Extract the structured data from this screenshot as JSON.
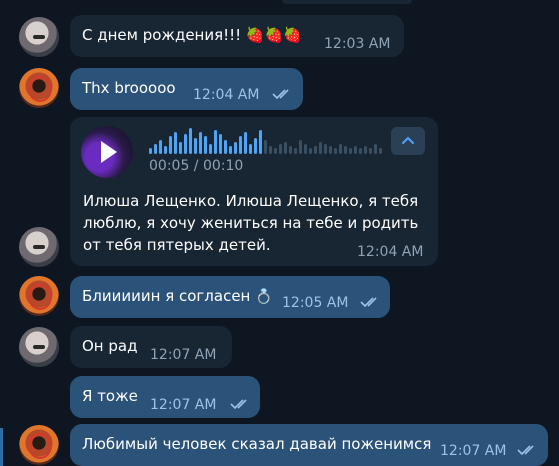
{
  "messages": [
    {
      "from": "friend",
      "text": "С днем рождения!!! 🍓🍓🍓",
      "time": "12:03 AM"
    },
    {
      "from": "me",
      "text": "Thx brooooo",
      "time": "12:04 AM",
      "read": true
    },
    {
      "from": "friend",
      "type": "voice",
      "duration": "00:05 / 00:10",
      "transcript": "Илюша Лещенко. Илюша Лещенко, я тебя люблю, я хочу жениться на тебе и родить от тебя пятерых детей.",
      "time": "12:04 AM"
    },
    {
      "from": "me",
      "text": "Блииииин я согласен",
      "emoji": "💍",
      "time": "12:05 AM",
      "read": true
    },
    {
      "from": "friend",
      "text": "Он рад",
      "time": "12:07 AM"
    },
    {
      "from": "me",
      "text": "Я тоже",
      "time": "12:07 AM",
      "read": true
    },
    {
      "from": "me",
      "text": "Любимый человек сказал давай поженимся",
      "time": "12:07 AM",
      "read": true
    }
  ],
  "colors": {
    "background": "#0e1621",
    "incoming_bubble": "#182533",
    "outgoing_bubble": "#2b5278",
    "accent": "#4ea4f6"
  }
}
